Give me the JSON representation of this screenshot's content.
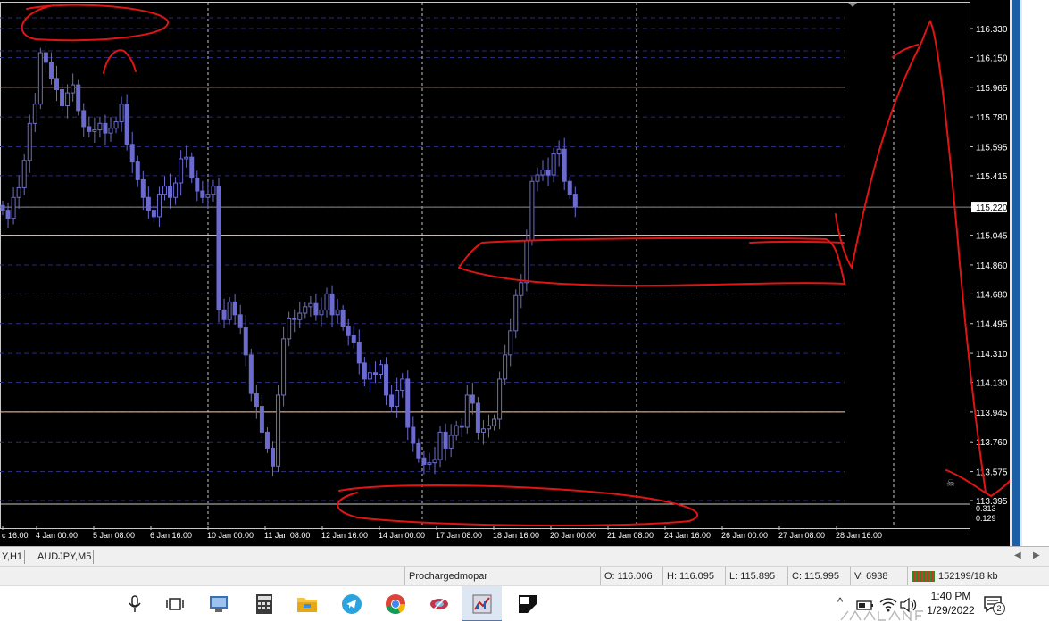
{
  "chart": {
    "symbol_tabs": [
      "Y,H1",
      "AUDJPY,M5"
    ],
    "price_axis_labels": [
      "116.330",
      "116.150",
      "115.965",
      "115.780",
      "115.595",
      "115.415",
      "115.220",
      "115.045",
      "114.860",
      "114.680",
      "114.495",
      "114.310",
      "114.130",
      "113.945",
      "113.760",
      "113.575",
      "113.395"
    ],
    "current_price": "115.220",
    "time_labels": [
      "c 16:00",
      "4 Jan 00:00",
      "5 Jan 08:00",
      "6 Jan 16:00",
      "10 Jan 00:00",
      "11 Jan 08:00",
      "12 Jan 16:00",
      "14 Jan 00:00",
      "17 Jan 08:00",
      "18 Jan 16:00",
      "20 Jan 00:00",
      "21 Jan 08:00",
      "24 Jan 16:00",
      "26 Jan 00:00",
      "27 Jan 08:00",
      "28 Jan 16:00"
    ],
    "indicator_labels": [
      "0.313",
      "0.129"
    ],
    "colors": {
      "background": "#000000",
      "candle": "#6b6bcf",
      "grid": "#2b2b7a",
      "horizontal_level": "#ffcc99",
      "annotation": "#e01414",
      "axis_text": "#ffffff"
    }
  },
  "chart_data": {
    "type": "candlestick",
    "ylim": [
      113.395,
      116.4
    ],
    "horizontal_levels": [
      115.965,
      115.045,
      113.945
    ],
    "close": [
      115.2,
      115.15,
      115.28,
      115.34,
      115.51,
      115.74,
      115.86,
      116.18,
      116.12,
      116.02,
      115.95,
      115.85,
      115.93,
      115.98,
      115.82,
      115.72,
      115.69,
      115.7,
      115.74,
      115.68,
      115.71,
      115.75,
      115.86,
      115.61,
      115.5,
      115.39,
      115.28,
      115.2,
      115.16,
      115.3,
      115.35,
      115.28,
      115.37,
      115.52,
      115.53,
      115.4,
      115.32,
      115.28,
      115.3,
      115.35,
      114.58,
      114.52,
      114.63,
      114.55,
      114.47,
      114.3,
      114.06,
      113.98,
      113.82,
      113.72,
      113.61,
      114.05,
      114.4,
      114.53,
      114.52,
      114.56,
      114.6,
      114.62,
      114.55,
      114.58,
      114.68,
      114.55,
      114.58,
      114.48,
      114.42,
      114.38,
      114.25,
      114.15,
      114.19,
      114.18,
      114.24,
      114.05,
      113.98,
      114.08,
      114.15,
      113.85,
      113.75,
      113.66,
      113.62,
      113.63,
      113.65,
      113.82,
      113.72,
      113.8,
      113.86,
      113.85,
      114.05,
      114.0,
      113.82,
      113.84,
      113.86,
      113.9,
      114.15,
      114.3,
      114.45,
      114.67,
      114.75,
      115.01,
      115.38,
      115.42,
      115.45,
      115.42,
      115.55,
      115.58,
      115.38,
      115.3,
      115.22
    ],
    "candle_count": 107,
    "annotations": [
      "circle top-left peak",
      "arc over second peak",
      "rectangle resistance zone 114.86-115.05",
      "ellipse bottom support",
      "projection arrow up then down"
    ]
  },
  "status": {
    "profile": "Prochargedmopar",
    "open": "O: 116.006",
    "high": "H: 116.095",
    "low": "L: 115.895",
    "close": "C: 115.995",
    "volume": "V: 6938",
    "traffic": "152199/18 kb"
  },
  "taskbar": {
    "time": "1:40 PM",
    "date": "1/29/2022",
    "notification_count": "2",
    "apps": [
      "microphone-icon",
      "task-view-icon",
      "network-app-icon",
      "calculator-icon",
      "file-explorer-icon",
      "telegram-icon",
      "chrome-icon",
      "app-icon",
      "metatrader-icon",
      "sticky-notes-icon"
    ]
  }
}
